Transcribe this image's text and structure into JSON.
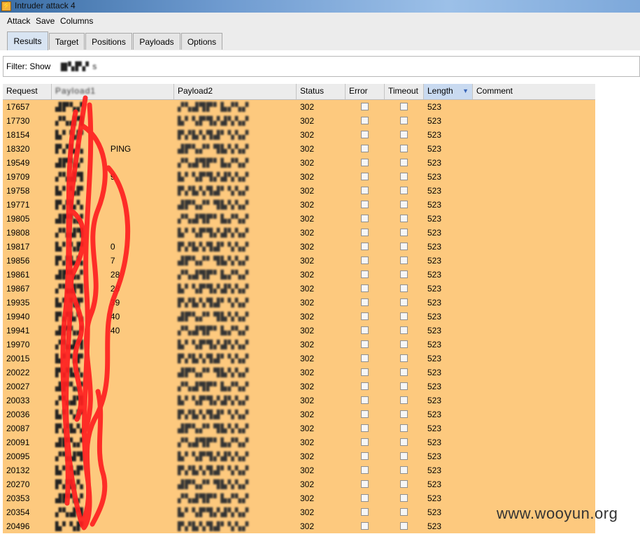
{
  "window": {
    "title": "Intruder attack 4"
  },
  "menu": [
    "Attack",
    "Save",
    "Columns"
  ],
  "tabs": [
    "Results",
    "Target",
    "Positions",
    "Payloads",
    "Options"
  ],
  "filter": {
    "label": "Filter: Show"
  },
  "columns": [
    "Request",
    "Payload1",
    "Payload2",
    "Status",
    "Error",
    "Timeout",
    "Length",
    "Comment"
  ],
  "rows": [
    {
      "request": "17657",
      "payload1": "",
      "status": "302",
      "length": "523"
    },
    {
      "request": "17730",
      "payload1": "",
      "status": "302",
      "length": "523"
    },
    {
      "request": "18154",
      "payload1": "",
      "status": "302",
      "length": "523"
    },
    {
      "request": "18320",
      "payload1": "PING",
      "status": "302",
      "length": "523"
    },
    {
      "request": "19549",
      "payload1": "",
      "status": "302",
      "length": "523"
    },
    {
      "request": "19709",
      "payload1": "9",
      "status": "302",
      "length": "523"
    },
    {
      "request": "19758",
      "payload1": "",
      "status": "302",
      "length": "523"
    },
    {
      "request": "19771",
      "payload1": "",
      "status": "302",
      "length": "523"
    },
    {
      "request": "19805",
      "payload1": "",
      "status": "302",
      "length": "523"
    },
    {
      "request": "19808",
      "payload1": "",
      "status": "302",
      "length": "523"
    },
    {
      "request": "19817",
      "payload1": "0",
      "status": "302",
      "length": "523"
    },
    {
      "request": "19856",
      "payload1": "7",
      "status": "302",
      "length": "523"
    },
    {
      "request": "19861",
      "payload1": "28",
      "status": "302",
      "length": "523"
    },
    {
      "request": "19867",
      "payload1": "28",
      "status": "302",
      "length": "523"
    },
    {
      "request": "19935",
      "payload1": "39",
      "status": "302",
      "length": "523"
    },
    {
      "request": "19940",
      "payload1": "40",
      "status": "302",
      "length": "523"
    },
    {
      "request": "19941",
      "payload1": "40",
      "status": "302",
      "length": "523"
    },
    {
      "request": "19970",
      "payload1": "",
      "status": "302",
      "length": "523"
    },
    {
      "request": "20015",
      "payload1": "",
      "status": "302",
      "length": "523"
    },
    {
      "request": "20022",
      "payload1": "",
      "status": "302",
      "length": "523"
    },
    {
      "request": "20027",
      "payload1": "",
      "status": "302",
      "length": "523"
    },
    {
      "request": "20033",
      "payload1": "",
      "status": "302",
      "length": "523"
    },
    {
      "request": "20036",
      "payload1": "",
      "status": "302",
      "length": "523"
    },
    {
      "request": "20087",
      "payload1": "",
      "status": "302",
      "length": "523"
    },
    {
      "request": "20091",
      "payload1": "",
      "status": "302",
      "length": "523"
    },
    {
      "request": "20095",
      "payload1": "",
      "status": "302",
      "length": "523"
    },
    {
      "request": "20132",
      "payload1": "",
      "status": "302",
      "length": "523"
    },
    {
      "request": "20270",
      "payload1": "",
      "status": "302",
      "length": "523"
    },
    {
      "request": "20353",
      "payload1": "",
      "status": "302",
      "length": "523"
    },
    {
      "request": "20354",
      "payload1": "",
      "status": "302",
      "length": "523"
    },
    {
      "request": "20496",
      "payload1": "",
      "status": "302",
      "length": "523"
    }
  ],
  "colors": {
    "row_bg": "#fdc97e",
    "sorted_header": "#c9daf0",
    "scribble": "#ff2020"
  },
  "sort": {
    "column": "Length",
    "direction": "descending"
  },
  "watermark": "www.wooyun.org",
  "icons": {
    "window": "lightning-icon",
    "sort": "sort-desc-icon"
  }
}
